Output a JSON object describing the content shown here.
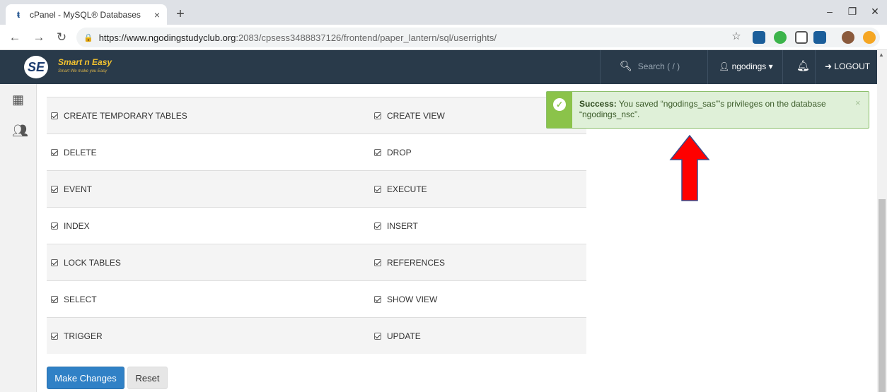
{
  "browser": {
    "tab_title": "cPanel - MySQL® Databases",
    "tab_close": "×",
    "new_tab": "+",
    "url_host": "https://www.ngodingstudyclub.org",
    "url_rest": ":2083/cpsess3488837126/frontend/paper_lantern/sql/userrights/",
    "minimize": "–",
    "restore": "❐",
    "close": "✕"
  },
  "header": {
    "logo_mark": "SE",
    "logo_name": "Smart n Easy",
    "logo_tagline": "Smart We make you Easy",
    "search_placeholder": "Search ( / )",
    "user_label": "ngodings ▾",
    "logout_label": "LOGOUT"
  },
  "privileges": {
    "rows": [
      {
        "left": "CREATE TEMPORARY TABLES",
        "right": "CREATE VIEW"
      },
      {
        "left": "DELETE",
        "right": "DROP"
      },
      {
        "left": "EVENT",
        "right": "EXECUTE"
      },
      {
        "left": "INDEX",
        "right": "INSERT"
      },
      {
        "left": "LOCK TABLES",
        "right": "REFERENCES"
      },
      {
        "left": "SELECT",
        "right": "SHOW VIEW"
      },
      {
        "left": "TRIGGER",
        "right": "UPDATE"
      }
    ]
  },
  "actions": {
    "make_changes": "Make Changes",
    "reset": "Reset"
  },
  "alert": {
    "label": "Success:",
    "message": "You saved “ngodings_sas”’s privileges on the database “ngodings_nsc”.",
    "close": "×"
  },
  "colors": {
    "header_bg": "#293a4a",
    "primary": "#3081c6",
    "success_bg": "#dff0d8",
    "success_accent": "#8bc34a",
    "arrow": "#ff0000"
  }
}
